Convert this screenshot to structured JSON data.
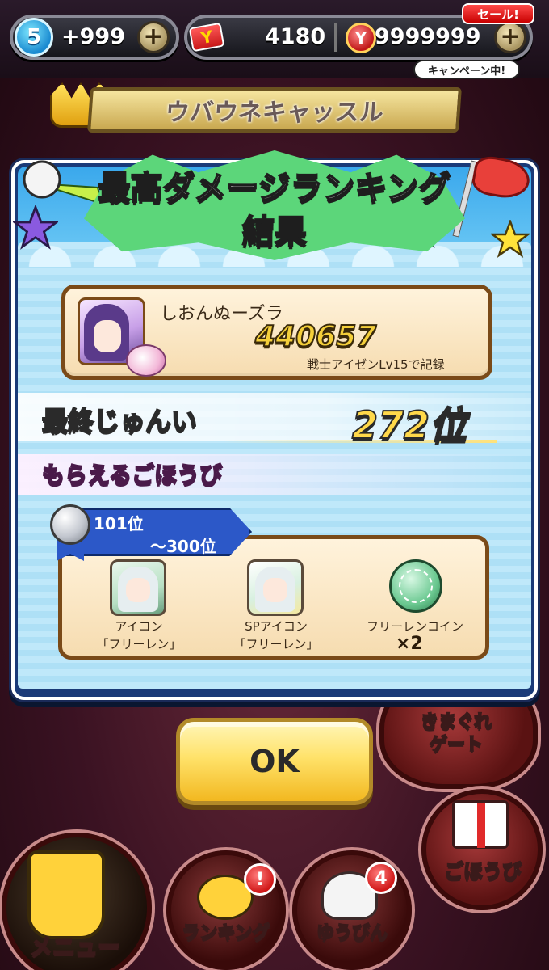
{
  "hud": {
    "stamina_level": "5",
    "stamina_value": "+999",
    "tickets": "4180",
    "money": "9999999",
    "sale_tag": "セール!",
    "campaign_tag": "キャンペーン中!"
  },
  "background": {
    "castle_name": "ウバウネキャッスル",
    "gate_label": "きまぐれ\nゲート",
    "menu_label": "メニュー",
    "ranking_label": "ランキング",
    "ranking_badge": "!",
    "mail_label": "ゆうびん",
    "mail_badge": "4",
    "reward_btn_label": "ごほうび"
  },
  "dialog": {
    "title_line1": "最高ダメージランキング",
    "title_line2": "結果",
    "player": {
      "name": "しおんぬーズラ",
      "score": "440657",
      "record": "戦士アイゼンLv15で記録"
    },
    "final_rank_label": "最終じゅんい",
    "final_rank_value": "272位",
    "rewards_label": "もらえるごほうび",
    "tier": {
      "top": "101位",
      "bottom": "～300位"
    },
    "rewards": [
      {
        "line1": "アイコン",
        "line2": "「フリーレン」",
        "icon": "frieren-icon"
      },
      {
        "line1": "SPアイコン",
        "line2": "「フリーレン」",
        "icon": "frieren-sp-icon"
      },
      {
        "line1": "フリーレンコイン",
        "line2": "×2",
        "icon": "frieren-coin-icon"
      }
    ],
    "ok_label": "OK"
  },
  "colors": {
    "dialog_frame": "#1a3a78",
    "title_burst": "#5cd67a",
    "ok_button": "#ffe26a",
    "tier_ribbon": "#2c58c8",
    "score_gold": "#f4cf3a"
  }
}
